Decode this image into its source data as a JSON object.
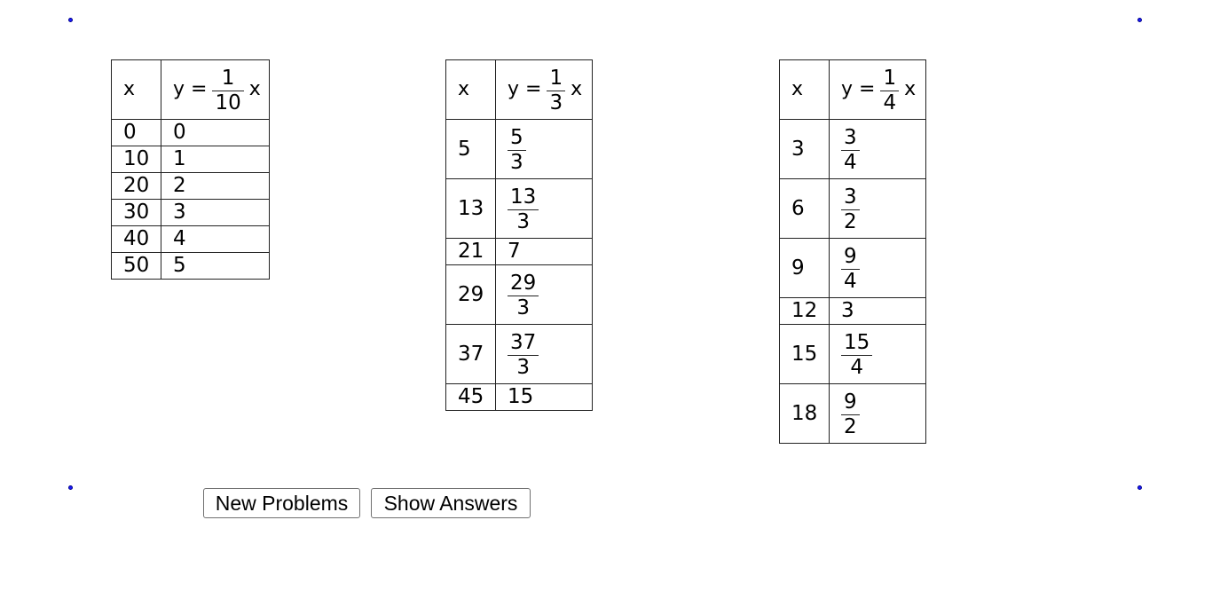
{
  "tables": [
    {
      "x_header": "x",
      "y_header": {
        "prefix": "y =",
        "num": "1",
        "den": "10",
        "suffix": "x"
      },
      "rows": [
        {
          "x": "0",
          "y": "0"
        },
        {
          "x": "10",
          "y": "1"
        },
        {
          "x": "20",
          "y": "2"
        },
        {
          "x": "30",
          "y": "3"
        },
        {
          "x": "40",
          "y": "4"
        },
        {
          "x": "50",
          "y": "5"
        }
      ]
    },
    {
      "x_header": "x",
      "y_header": {
        "prefix": "y =",
        "num": "1",
        "den": "3",
        "suffix": "x"
      },
      "rows": [
        {
          "x": "5",
          "num": "5",
          "den": "3"
        },
        {
          "x": "13",
          "num": "13",
          "den": "3"
        },
        {
          "x": "21",
          "y": "7"
        },
        {
          "x": "29",
          "num": "29",
          "den": "3"
        },
        {
          "x": "37",
          "num": "37",
          "den": "3"
        },
        {
          "x": "45",
          "y": "15"
        }
      ]
    },
    {
      "x_header": "x",
      "y_header": {
        "prefix": "y =",
        "num": "1",
        "den": "4",
        "suffix": "x"
      },
      "rows": [
        {
          "x": "3",
          "num": "3",
          "den": "4"
        },
        {
          "x": "6",
          "num": "3",
          "den": "2"
        },
        {
          "x": "9",
          "num": "9",
          "den": "4"
        },
        {
          "x": "12",
          "y": "3"
        },
        {
          "x": "15",
          "num": "15",
          "den": "4"
        },
        {
          "x": "18",
          "num": "9",
          "den": "2"
        }
      ]
    }
  ],
  "buttons": {
    "new_problems": "New Problems",
    "show_answers": "Show Answers"
  },
  "colors": {
    "corner_point": "#1a1aff"
  }
}
